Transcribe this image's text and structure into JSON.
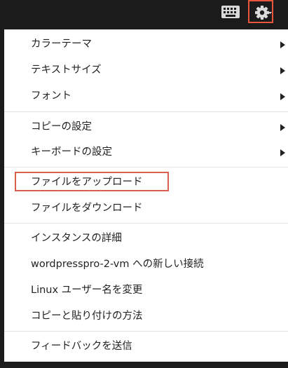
{
  "topbar": {
    "icons": [
      "keyboard-icon",
      "gear-icon"
    ],
    "highlight_color": "#e8553b"
  },
  "menu": {
    "groups": [
      [
        {
          "label": "カラーテーマ",
          "submenu": true
        },
        {
          "label": "テキストサイズ",
          "submenu": true
        },
        {
          "label": "フォント",
          "submenu": true
        }
      ],
      [
        {
          "label": "コピーの設定",
          "submenu": true
        },
        {
          "label": "キーボードの設定",
          "submenu": true
        }
      ],
      [
        {
          "label": "ファイルをアップロード",
          "submenu": false,
          "highlighted": true
        },
        {
          "label": "ファイルをダウンロード",
          "submenu": false
        }
      ],
      [
        {
          "label": "インスタンスの詳細",
          "submenu": false
        },
        {
          "label": "wordpresspro-2-vm への新しい接続",
          "submenu": false
        },
        {
          "label": "Linux ユーザー名を変更",
          "submenu": false
        },
        {
          "label": "コピーと貼り付けの方法",
          "submenu": false
        }
      ],
      [
        {
          "label": "フィードバックを送信",
          "submenu": false
        }
      ]
    ]
  }
}
